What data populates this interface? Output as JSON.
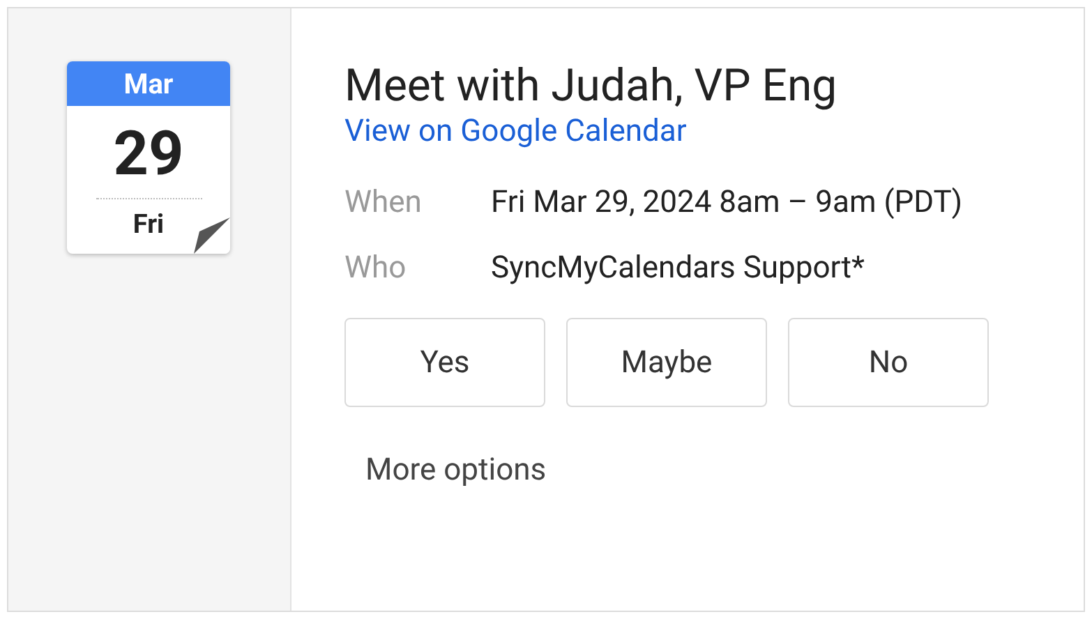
{
  "calendar_icon": {
    "month": "Mar",
    "day": "29",
    "weekday": "Fri"
  },
  "event": {
    "title": "Meet with Judah, VP Eng",
    "link": "View on Google Calendar"
  },
  "details": [
    {
      "label": "When",
      "value": "Fri Mar 29, 2024 8am – 9am (PDT)"
    },
    {
      "label": "Who",
      "value": "SyncMyCalendars Support*"
    }
  ],
  "rsvp_buttons": [
    {
      "label": "Yes"
    },
    {
      "label": "Maybe"
    },
    {
      "label": "No"
    }
  ],
  "more_options": "More options"
}
